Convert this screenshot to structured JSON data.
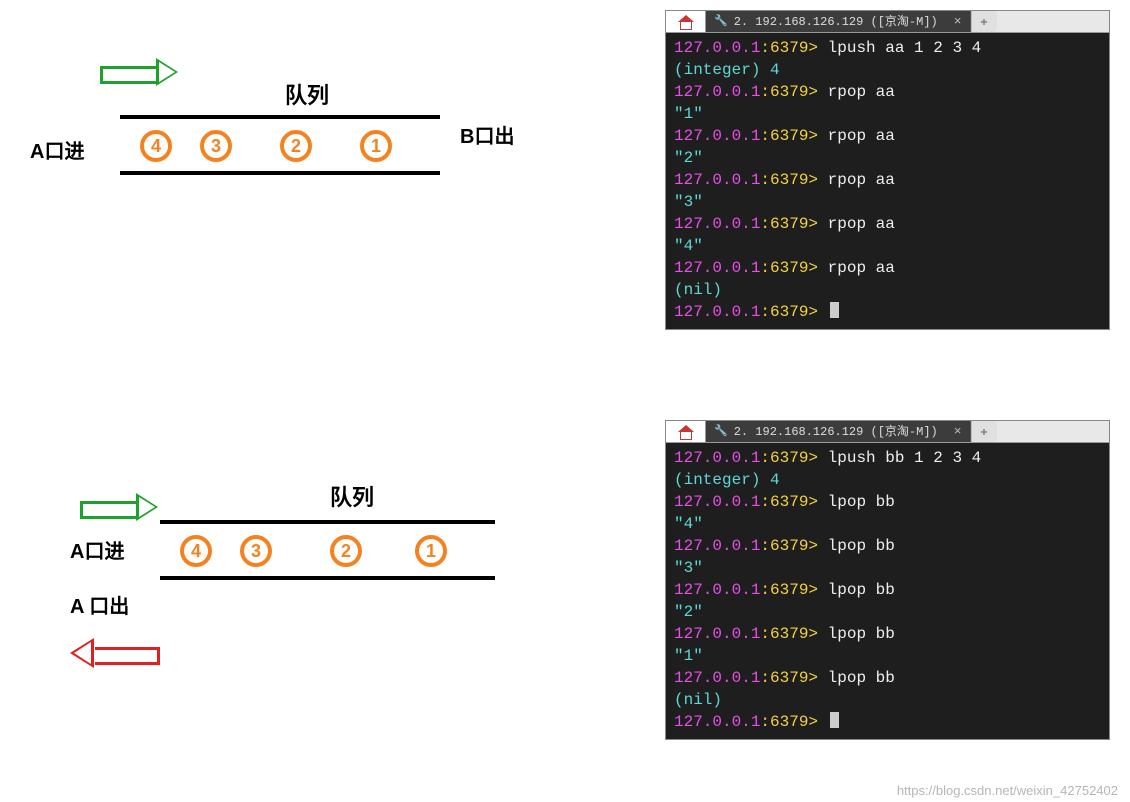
{
  "diagram1": {
    "title": "队列",
    "label_in": "A口进",
    "label_out": "B口出",
    "items": [
      "4",
      "3",
      "2",
      "1"
    ]
  },
  "diagram2": {
    "title": "队列",
    "label_in": "A口进",
    "label_out": "A 口出",
    "items": [
      "4",
      "3",
      "2",
      "1"
    ]
  },
  "terminal1": {
    "tab_title": "2. 192.168.126.129 ([京淘-M])",
    "prompt_host": "127.0.0.1",
    "prompt_port": ":6379>",
    "lines": [
      {
        "cmd": "lpush aa 1 2 3 4"
      },
      {
        "out": "(integer) 4"
      },
      {
        "cmd": "rpop aa"
      },
      {
        "out": "\"1\""
      },
      {
        "cmd": "rpop aa"
      },
      {
        "out": "\"2\""
      },
      {
        "cmd": "rpop aa"
      },
      {
        "out": "\"3\""
      },
      {
        "cmd": "rpop aa"
      },
      {
        "out": "\"4\""
      },
      {
        "cmd": "rpop aa"
      },
      {
        "out": "(nil)"
      },
      {
        "prompt_only": true
      }
    ]
  },
  "terminal2": {
    "tab_title": "2. 192.168.126.129 ([京淘-M])",
    "prompt_host": "127.0.0.1",
    "prompt_port": ":6379>",
    "lines": [
      {
        "cmd": "lpush bb 1 2 3 4"
      },
      {
        "out": "(integer) 4"
      },
      {
        "cmd": "lpop bb"
      },
      {
        "out": "\"4\""
      },
      {
        "cmd": "lpop bb"
      },
      {
        "out": "\"3\""
      },
      {
        "cmd": "lpop bb"
      },
      {
        "out": "\"2\""
      },
      {
        "cmd": "lpop bb"
      },
      {
        "out": "\"1\""
      },
      {
        "cmd": "lpop bb"
      },
      {
        "out": "(nil)"
      },
      {
        "prompt_only": true
      }
    ]
  },
  "watermark": "https://blog.csdn.net/weixin_42752402"
}
